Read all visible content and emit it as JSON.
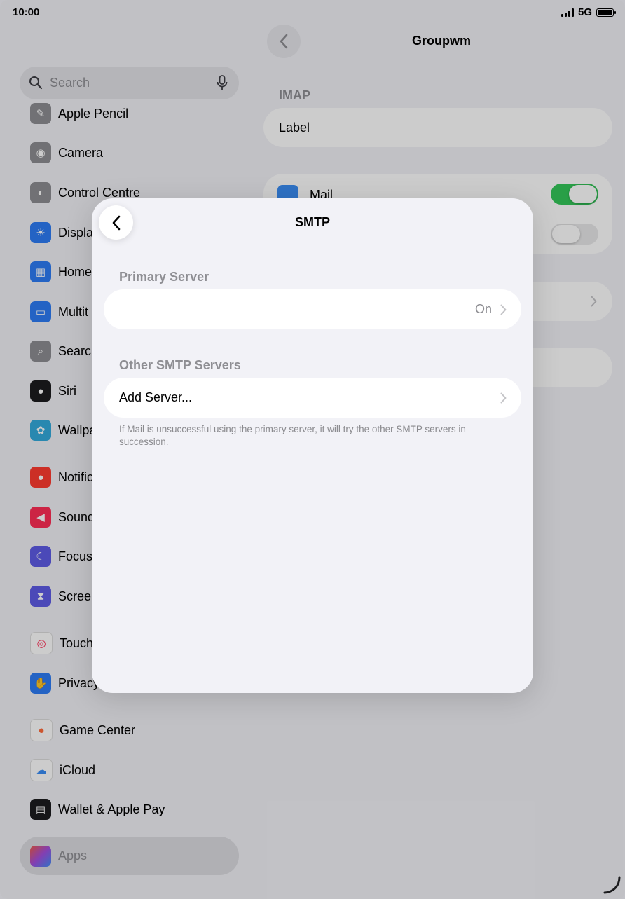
{
  "status_bar": {
    "time": "10:00",
    "network": "5G"
  },
  "sidebar": {
    "search_placeholder": "Search",
    "items": [
      {
        "label": "Apple Pencil",
        "icon": "pencil-icon",
        "color": "#8e8e93"
      },
      {
        "label": "Camera",
        "icon": "camera-icon",
        "color": "#8e8e93"
      },
      {
        "label": "Control Centre",
        "icon": "toggles-icon",
        "color": "#8e8e93"
      },
      {
        "label": "Displa",
        "icon": "brightness-icon",
        "color": "#2d7cf6"
      },
      {
        "label": "Home",
        "icon": "home-screen-icon",
        "color": "#2d7cf6"
      },
      {
        "label": "Multit",
        "icon": "multitasking-icon",
        "color": "#2d7cf6"
      },
      {
        "label": "Searc",
        "icon": "search-icon",
        "color": "#8e8e93"
      },
      {
        "label": "Siri",
        "icon": "siri-icon",
        "color": "#1c1c1e"
      },
      {
        "label": "Wallpa",
        "icon": "wallpaper-icon",
        "color": "#34aadc"
      },
      {
        "label": "Notific",
        "icon": "notifications-icon",
        "color": "#ff3b30"
      },
      {
        "label": "Sound",
        "icon": "speaker-icon",
        "color": "#ff2d55"
      },
      {
        "label": "Focus",
        "icon": "moon-icon",
        "color": "#5e5ce6"
      },
      {
        "label": "Scree",
        "icon": "hourglass-icon",
        "color": "#5e5ce6"
      },
      {
        "label": "Touch",
        "icon": "fingerprint-icon",
        "color": "#ffffff"
      },
      {
        "label": "Privacy",
        "icon": "hand-icon",
        "color": "#2d7cf6"
      },
      {
        "label": "Game Center",
        "icon": "game-center-icon",
        "color": "#ffffff"
      },
      {
        "label": "iCloud",
        "icon": "cloud-icon",
        "color": "#ffffff"
      },
      {
        "label": "Wallet & Apple Pay",
        "icon": "wallet-icon",
        "color": "#1c1c1e"
      }
    ],
    "apps_label": "Apps"
  },
  "detail": {
    "title": "Groupwm",
    "imap_header": "IMAP",
    "label_row": "Label",
    "mail_label": "Mail",
    "mail_toggle_on": true,
    "second_toggle_on": false
  },
  "modal": {
    "title": "SMTP",
    "primary_header": "Primary Server",
    "primary_value": "On",
    "other_header": "Other SMTP Servers",
    "add_server_label": "Add Server...",
    "footer_note": "If Mail is unsuccessful using the primary server, it will try the other SMTP servers in succession."
  },
  "colors": {
    "accent_green": "#34c759",
    "toggle_off": "#e9e9ea"
  }
}
